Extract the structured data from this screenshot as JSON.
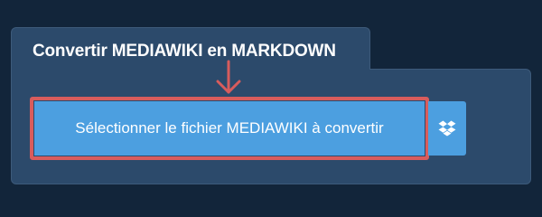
{
  "panel": {
    "title": "Convertir MEDIAWIKI en MARKDOWN"
  },
  "upload": {
    "select_file_label": "Sélectionner le fichier MEDIAWIKI à convertir",
    "dropbox_icon": "dropbox-icon"
  },
  "colors": {
    "page_background": "#12253a",
    "panel_background": "#2c4a6b",
    "button_background": "#4c9fe0",
    "highlight": "#d85c5c"
  }
}
